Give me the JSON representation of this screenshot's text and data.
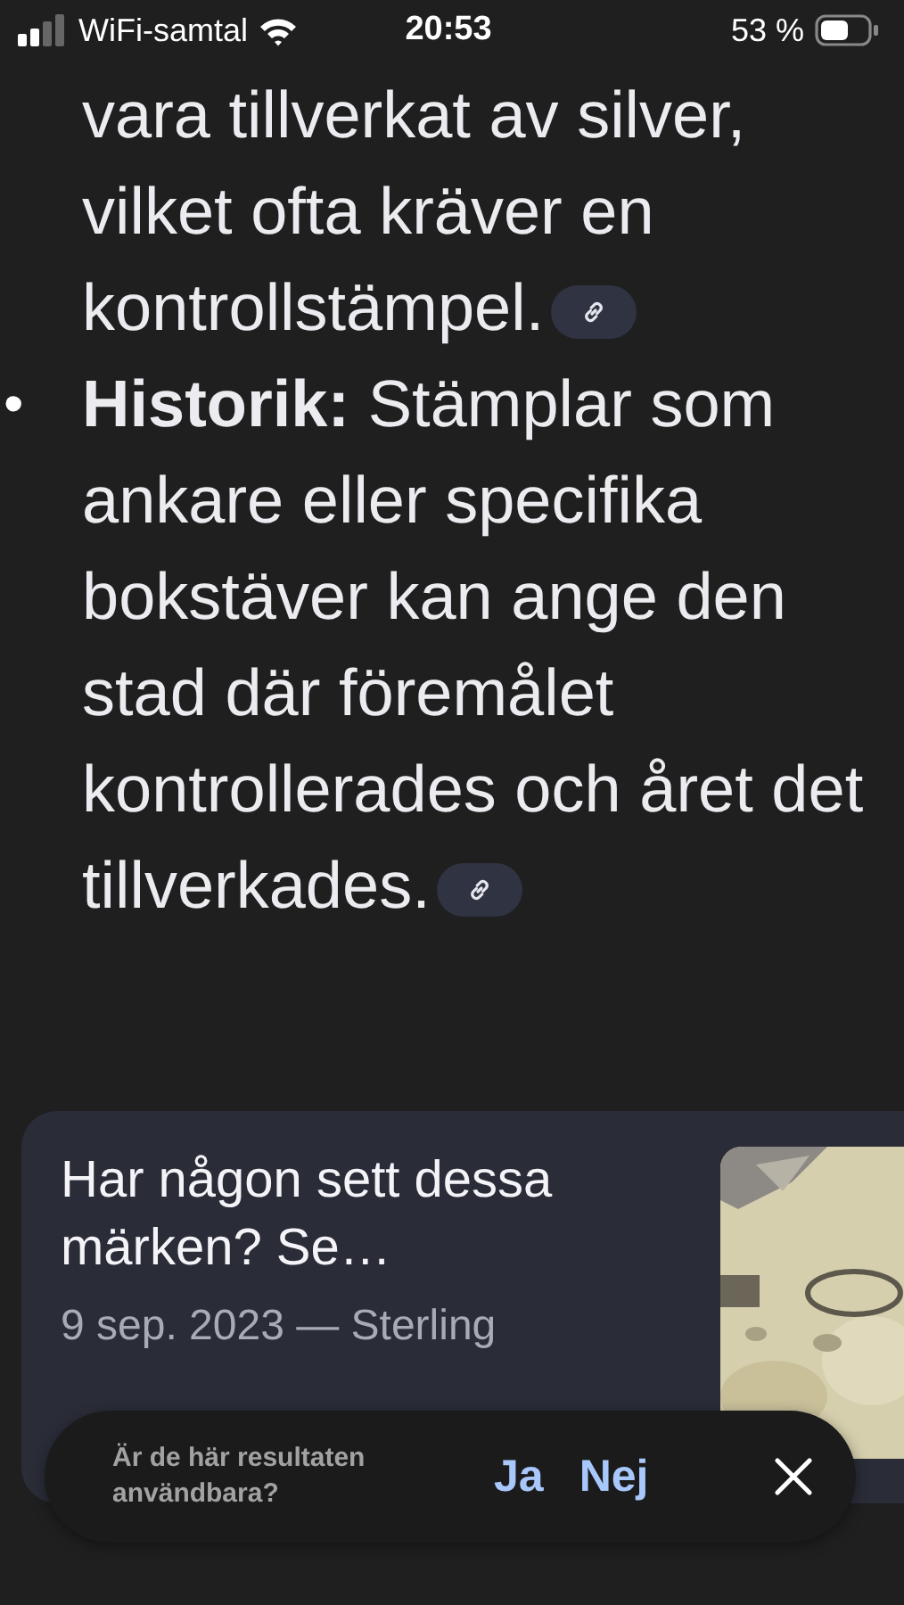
{
  "status_bar": {
    "carrier": "WiFi-samtal",
    "time": "20:53",
    "battery": "53 %"
  },
  "paragraphs": [
    {
      "text": "vara tillverkat av silver, vilket ofta kräver en kontrollstämpel."
    },
    {
      "bullet": "•",
      "text": "**Historik:** Stämplar som ankare eller specifika bokstäver kan ange den stad där föremålet kontrollerades och året det tillverkades."
    }
  ],
  "result_card": {
    "title": "Har någon sett dessa märken? Se…",
    "snippet": "9 sep. 2023 — Sterling"
  },
  "feedback": {
    "question": "Är de här resultaten användbara?",
    "yes": "Ja",
    "no": "Nej"
  }
}
